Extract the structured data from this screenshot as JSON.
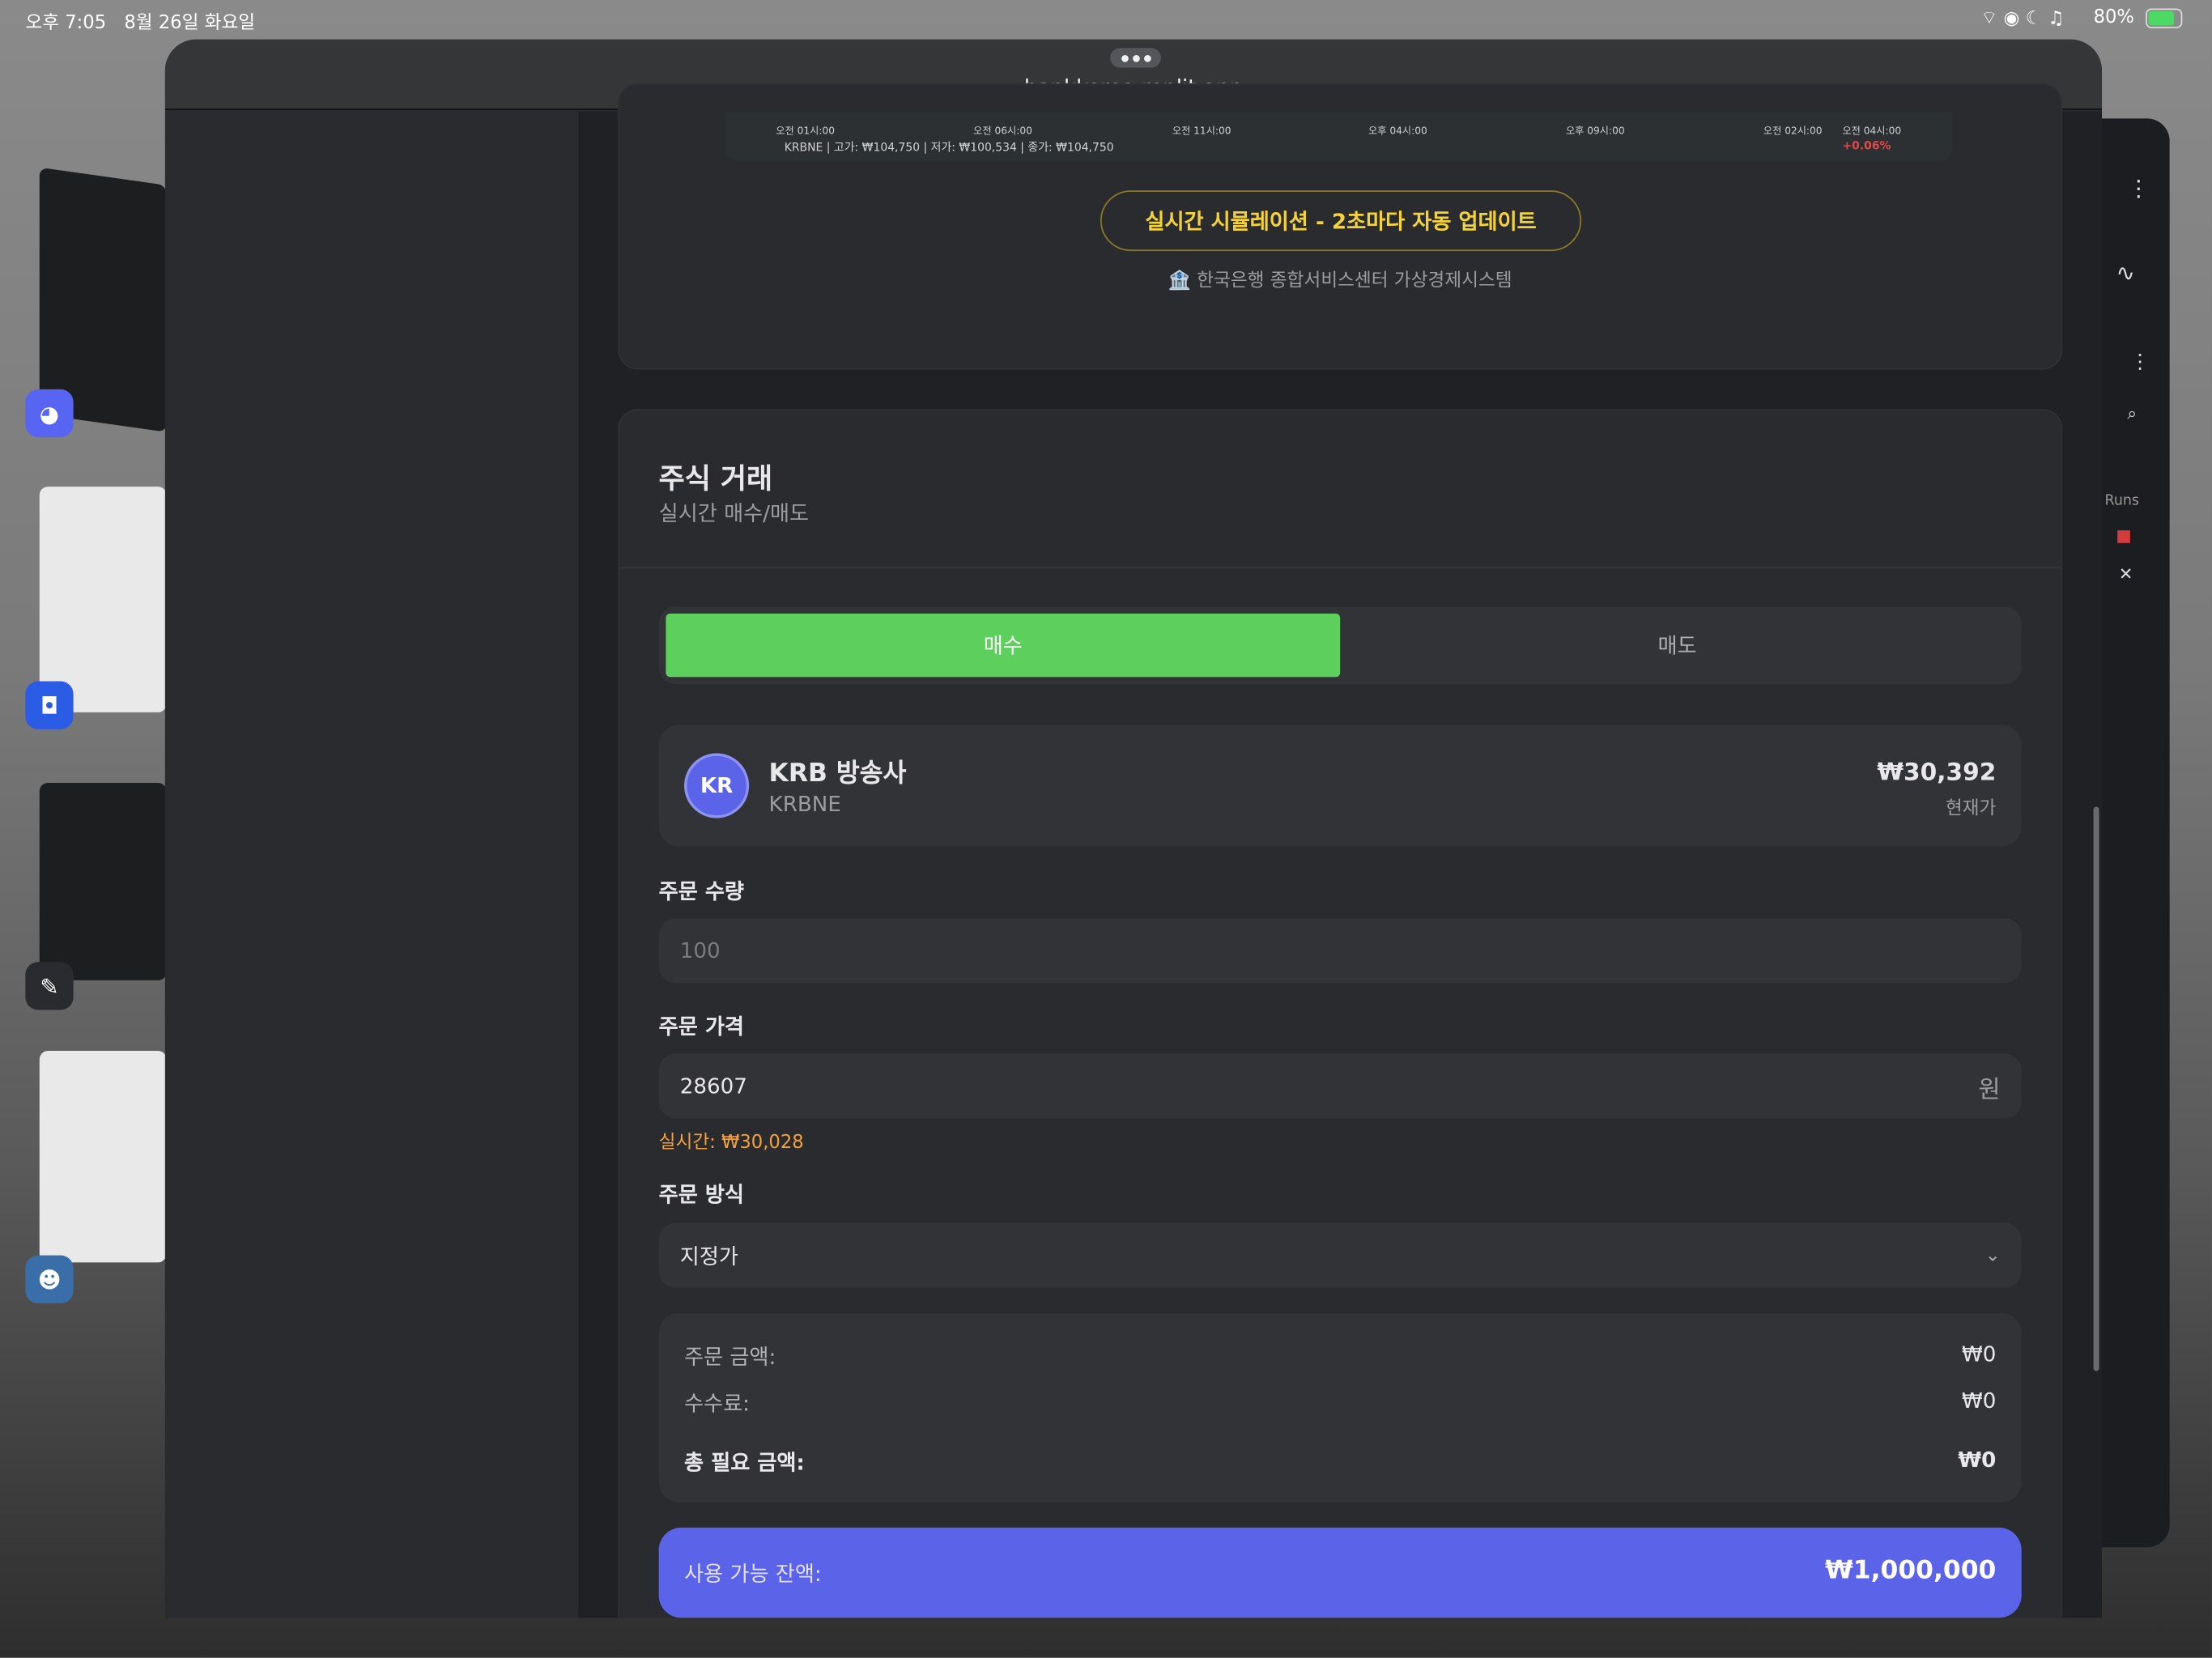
{
  "status_bar": {
    "time": "오후 7:05",
    "date": "8월 26일 화요일",
    "battery": "80%"
  },
  "browser": {
    "url": "bankkorea.replit.app"
  },
  "chart_strip": {
    "ticks": [
      "오전 01시:00",
      "오전 06시:00",
      "오전 11시:00",
      "오후 04시:00",
      "오후 09시:00",
      "오전 02시:00",
      "오전 04시:00"
    ],
    "summary": "KRBNE | 고가: ₩104,750 | 저가: ₩100,534 | 종가: ₩104,750",
    "change": "+0.06%"
  },
  "simulation": {
    "button": "실시간 시뮬레이션 - 2초마다 자동 업데이트",
    "caption": "🏦 한국은행 종합서비스센터 가상경제시스템"
  },
  "trade": {
    "title": "주식 거래",
    "subtitle": "실시간 매수/매도",
    "tabs": [
      {
        "label": "매수",
        "active": true
      },
      {
        "label": "매도",
        "active": false
      }
    ],
    "stock": {
      "avatar": "KR",
      "name": "KRB 방송사",
      "ticker": "KRBNE",
      "price": "₩30,392",
      "price_label": "현재가"
    },
    "quantity": {
      "label": "주문 수량",
      "placeholder": "100"
    },
    "price": {
      "label": "주문 가격",
      "value": "28607",
      "unit": "원",
      "realtime": "실시간: ₩30,028"
    },
    "order_type": {
      "label": "주문 방식",
      "value": "지정가"
    },
    "summary": [
      {
        "label": "주문 금액:",
        "value": "₩0"
      },
      {
        "label": "수수료:",
        "value": "₩0"
      },
      {
        "label": "총 필요 금액:",
        "value": "₩0"
      }
    ],
    "balance": {
      "label": "사용 가능 잔액:",
      "value": "₩1,000,000"
    }
  },
  "right_panel": {
    "runs": "Runs"
  },
  "colors": {
    "buy": "#5ccf5c",
    "accent": "#5b63e8",
    "warn": "#f5a03a",
    "yellow": "#f4d23a",
    "down": "#e04848"
  }
}
